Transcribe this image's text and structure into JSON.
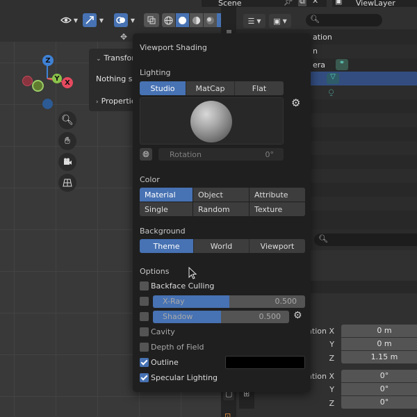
{
  "topbar": {
    "scene_value": "Scene",
    "view_layer_value": "ViewLayer"
  },
  "viewport": {
    "npanel": {
      "transform_label": "Transfor",
      "nothing_label": "Nothing se",
      "properties_label": "Propertie"
    },
    "gizmo": {
      "x": "X",
      "y": "Y",
      "z": "Z"
    }
  },
  "outliner": {
    "rows": [
      "ation",
      "n",
      "era"
    ]
  },
  "properties": {
    "location": {
      "x_label": "ation X",
      "y_label": "Y",
      "z_label": "Z",
      "x": "0 m",
      "y": "0 m",
      "z": "1.15 m"
    },
    "rotation": {
      "x_label": "ation X",
      "y_label": "Y",
      "z_label": "Z",
      "x": "0°",
      "y": "0°",
      "z": "0°"
    }
  },
  "popover": {
    "title": "Viewport Shading",
    "lighting": {
      "heading": "Lighting",
      "options": [
        "Studio",
        "MatCap",
        "Flat"
      ],
      "selected": "Studio",
      "rotation_label": "Rotation",
      "rotation_value": "0°"
    },
    "color": {
      "heading": "Color",
      "options": [
        "Material",
        "Object",
        "Attribute",
        "Single",
        "Random",
        "Texture"
      ],
      "selected": "Material"
    },
    "background": {
      "heading": "Background",
      "options": [
        "Theme",
        "World",
        "Viewport"
      ],
      "selected": "Theme"
    },
    "options": {
      "heading": "Options",
      "backface_culling": {
        "label": "Backface Culling",
        "checked": false
      },
      "xray": {
        "label": "X-Ray",
        "value": "0.500",
        "fraction": 0.5,
        "checked": false
      },
      "shadow": {
        "label": "Shadow",
        "value": "0.500",
        "fraction": 0.5,
        "checked": false
      },
      "cavity": {
        "label": "Cavity",
        "checked": false
      },
      "depth_of_field": {
        "label": "Depth of Field",
        "checked": false
      },
      "outline": {
        "label": "Outline",
        "checked": true,
        "color": "#000000"
      },
      "specular_lighting": {
        "label": "Specular Lighting",
        "checked": true
      }
    }
  },
  "colors": {
    "accent": "#4772b3",
    "gizmo_x": "#e64a5f",
    "gizmo_y": "#8bc34a",
    "gizmo_z": "#3f82d6"
  }
}
